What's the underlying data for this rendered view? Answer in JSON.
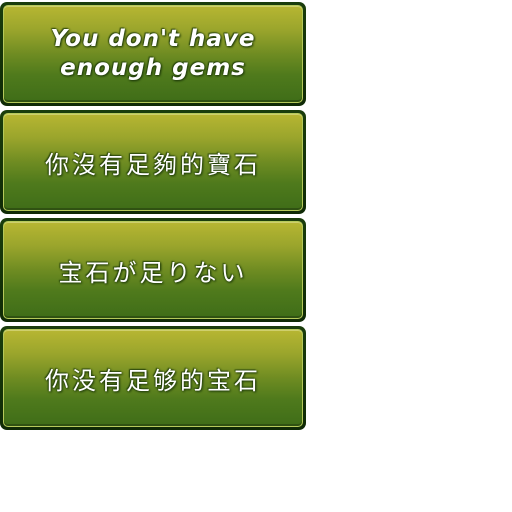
{
  "messages": [
    {
      "lang": "en",
      "text": "You don't have enough gems"
    },
    {
      "lang": "zh-Hant",
      "text": "你沒有足夠的寶石"
    },
    {
      "lang": "ja",
      "text": "宝石が足りない"
    },
    {
      "lang": "zh-Hans",
      "text": "你没有足够的宝石"
    }
  ],
  "colors": {
    "banner_top": "#b7b632",
    "banner_bottom": "#3f6d18",
    "border": "#1a3d0c",
    "text": "#ffffff"
  }
}
